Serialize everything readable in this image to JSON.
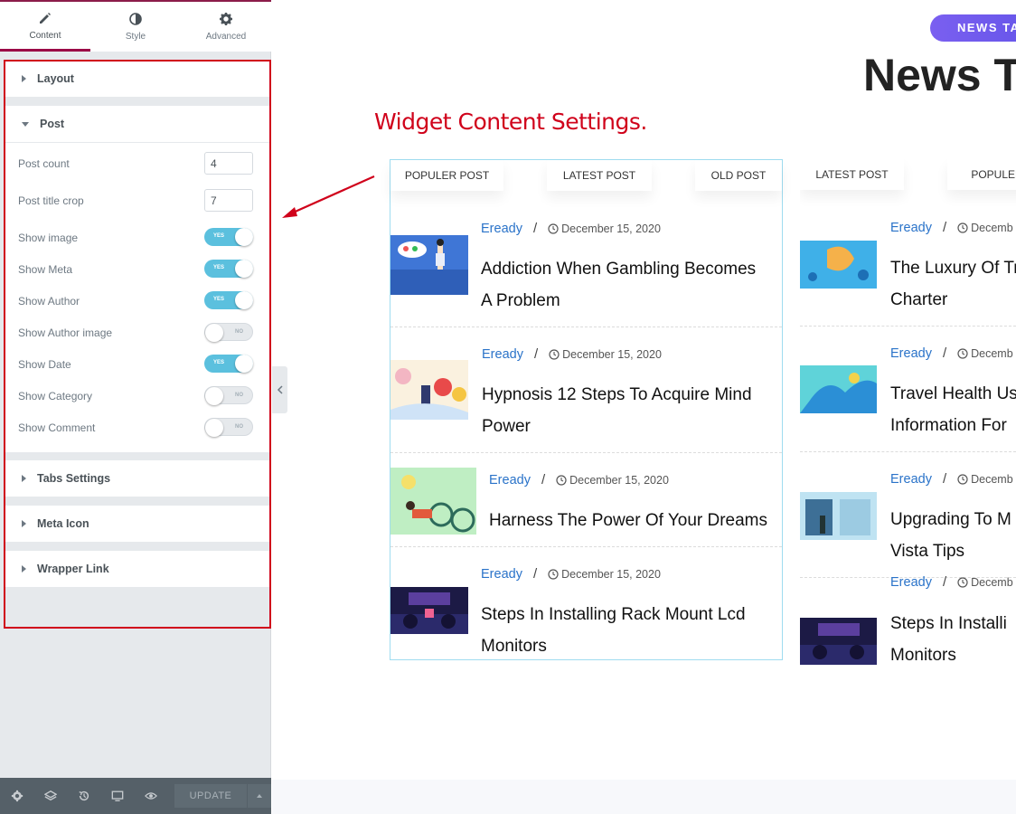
{
  "panel": {
    "tabs": [
      {
        "label": "Content",
        "icon": "pencil-icon"
      },
      {
        "label": "Style",
        "icon": "half-circle-icon"
      },
      {
        "label": "Advanced",
        "icon": "gear-icon"
      }
    ],
    "sections": {
      "layout": "Layout",
      "post": "Post",
      "tabs_settings": "Tabs Settings",
      "meta_icon": "Meta Icon",
      "wrapper_link": "Wrapper Link"
    },
    "controls": {
      "post_count": {
        "label": "Post count",
        "value": "4"
      },
      "post_title_crop": {
        "label": "Post title crop",
        "value": "7"
      },
      "show_image": {
        "label": "Show image",
        "state": "YES"
      },
      "show_meta": {
        "label": "Show Meta",
        "state": "YES"
      },
      "show_author": {
        "label": "Show Author",
        "state": "YES"
      },
      "show_author_image": {
        "label": "Show Author image",
        "state": "NO"
      },
      "show_date": {
        "label": "Show Date",
        "state": "YES"
      },
      "show_category": {
        "label": "Show Category",
        "state": "NO"
      },
      "show_comment": {
        "label": "Show Comment",
        "state": "NO"
      }
    },
    "bottom_bar": {
      "icons": [
        "gear-icon",
        "layers-icon",
        "history-icon",
        "responsive-icon",
        "eye-icon"
      ],
      "update_label": "UPDATE"
    }
  },
  "canvas": {
    "badge": "NEWS TA",
    "title": "News Ta",
    "annotation": "Widget Content Settings.",
    "widget1": {
      "tabs": [
        "POPULER POST",
        "LATEST POST",
        "OLD POST"
      ],
      "posts": [
        {
          "author": "Eready",
          "date": "December 15, 2020",
          "title_line1": "Addiction When Gambling Becomes",
          "title_line2": "A Problem"
        },
        {
          "author": "Eready",
          "date": "December 15, 2020",
          "title_line1": "Hypnosis 12 Steps To Acquire Mind",
          "title_line2": "Power"
        },
        {
          "author": "Eready",
          "date": "December 15, 2020",
          "title_line1": "Harness The Power Of Your Dreams",
          "title_line2": ""
        },
        {
          "author": "Eready",
          "date": "December 15, 2020",
          "title_line1": "Steps In Installing Rack Mount Lcd",
          "title_line2": "Monitors"
        }
      ]
    },
    "widget2": {
      "tabs": [
        "LATEST POST",
        "POPULER"
      ],
      "posts": [
        {
          "author": "Eready",
          "date": "Decemb",
          "title_line1": "The Luxury Of Tr",
          "title_line2": "Charter"
        },
        {
          "author": "Eready",
          "date": "Decemb",
          "title_line1": "Travel Health Us",
          "title_line2": "Information For"
        },
        {
          "author": "Eready",
          "date": "Decemb",
          "title_line1": "Upgrading To M",
          "title_line2": "Vista Tips"
        },
        {
          "author": "Eready",
          "date": "Decemb",
          "title_line1": "Steps In Installi",
          "title_line2": "Monitors"
        }
      ]
    }
  },
  "colors": {
    "accent": "#9b0a46",
    "switch_on": "#5bc0de",
    "annotation_red": "#d0021b",
    "author_link": "#2a73c9",
    "badge": "#6254e8"
  }
}
